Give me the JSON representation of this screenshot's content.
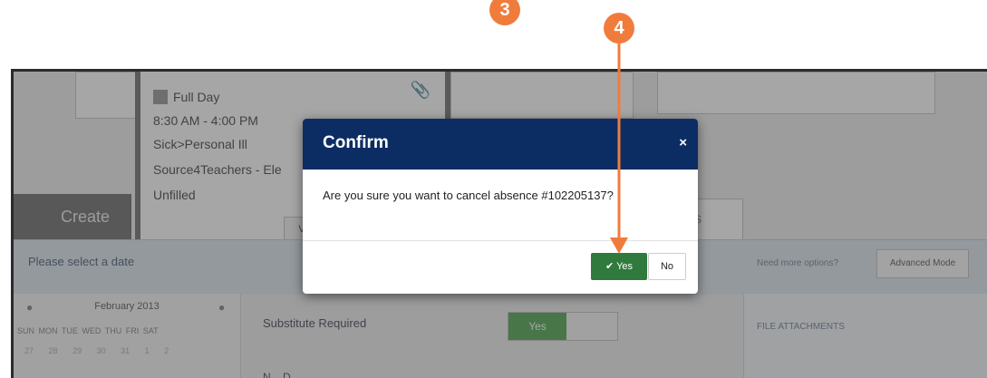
{
  "annotations": {
    "step_3": "3",
    "step_4": "4",
    "accent_color": "#f07c3c"
  },
  "background": {
    "absence_popover": {
      "day_type": "Full Day",
      "time": "8:30 AM - 4:00 PM",
      "reason": "Sick>Personal Ill",
      "source": "Source4Teachers - Ele",
      "status": "Unfilled",
      "view_button": "Vi"
    },
    "create_tab": "Create",
    "right_tab": "S",
    "select_bar": {
      "label": "Please select a date",
      "more_options": "Need more options?",
      "advanced_mode": "Advanced Mode"
    },
    "calendar": {
      "month": "February 2013",
      "days": [
        "SUN",
        "MON",
        "TUE",
        "WED",
        "THU",
        "FRI",
        "SAT"
      ],
      "first_week": [
        "27",
        "28",
        "29",
        "30",
        "31",
        "1",
        "2"
      ]
    },
    "substitute_required": "Substitute Required",
    "substitute_value": "Yes",
    "file_attachments": "FILE ATTACHMENTS",
    "partial_label": "N... D..."
  },
  "modal": {
    "title": "Confirm",
    "close": "×",
    "message": "Are you sure you want to cancel absence #102205137?",
    "yes_label": "Yes",
    "no_label": "No",
    "header_color": "#0c2d63",
    "yes_color": "#2f7a3c"
  }
}
